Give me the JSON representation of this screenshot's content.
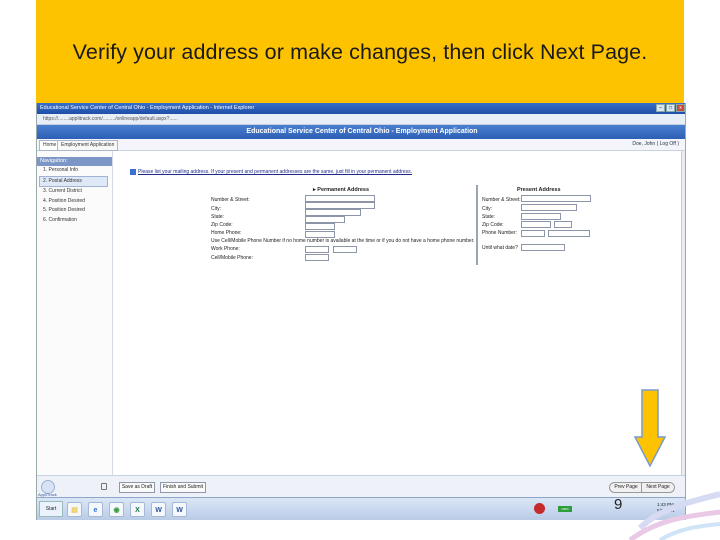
{
  "banner": {
    "title": "Verify your address or make changes, then click Next Page."
  },
  "browser": {
    "window_title": "Educational Service Center of Central Ohio - Employment Application - Internet Explorer",
    "url": "https://........applitrack.com/........./onlineapp/default.aspx?......",
    "min_label": "–",
    "max_label": "□",
    "close_label": "x"
  },
  "app": {
    "header_title": "Educational Service Center of Central Ohio - Employment Application",
    "tabs": [
      {
        "label": "Home"
      },
      {
        "label": "Employment Application"
      }
    ],
    "user_link": "Doe, John ( Log Off )"
  },
  "nav": {
    "heading": "Navigation:",
    "items": [
      {
        "label": "1. Personal Info"
      },
      {
        "label": "2. Postal Address"
      },
      {
        "label": "3. Current District"
      },
      {
        "label": "4. Position Desired"
      },
      {
        "label": "5. Position Desired"
      },
      {
        "label": "6. Confirmation"
      }
    ],
    "active_index": 1
  },
  "form": {
    "notice": "Please list your mailing address. If your present and permanent addresses are the same, just fill in your permanent address.",
    "permanent": {
      "heading": "▸ Permanent Address",
      "fields": [
        {
          "label": "Number & Street:"
        },
        {
          "label": "City:"
        },
        {
          "label": "State:"
        },
        {
          "label": "Zip Code:"
        },
        {
          "label": "Home Phone:"
        },
        {
          "label": "Use Cell/Mobile Phone Number if no home number is available at the time or if you do not have a home phone number."
        },
        {
          "label": "Work Phone:"
        },
        {
          "label": "Cell/Mobile Phone:"
        }
      ]
    },
    "present": {
      "heading": "Present Address",
      "fields": [
        {
          "label": "Number & Street:"
        },
        {
          "label": "City:"
        },
        {
          "label": "State:"
        },
        {
          "label": "Zip Code:"
        },
        {
          "label": "Phone Number:"
        },
        {
          "label": "Until what date?"
        }
      ]
    }
  },
  "footer": {
    "logo_text": "AppliTrack",
    "save_label": "Save as Draft",
    "finish_label": "Finish and Submit",
    "prev_label": "Prev Page",
    "next_label": "Next Page"
  },
  "taskbar": {
    "start_label": "Start",
    "icons": [
      {
        "name": "folder-icon",
        "glyph": "▤",
        "color": "#e8c64a"
      },
      {
        "name": "ie-icon",
        "glyph": "e",
        "color": "#2f74d0"
      },
      {
        "name": "chrome-icon",
        "glyph": "◉",
        "color": "#3c9a3c"
      },
      {
        "name": "excel-icon",
        "glyph": "X",
        "color": "#207245"
      },
      {
        "name": "word-icon",
        "glyph": "W",
        "color": "#2b579a"
      },
      {
        "name": "word-icon-2",
        "glyph": "W",
        "color": "#2b579a"
      }
    ],
    "battery_label": "100%",
    "clock_time": "1:43 PM",
    "clock_date": "5/5/2014"
  },
  "slide": {
    "number": "9"
  },
  "colors": {
    "banner": "#fdc300",
    "arrow_fill": "#fdc300",
    "arrow_stroke": "#7a9bc9"
  }
}
